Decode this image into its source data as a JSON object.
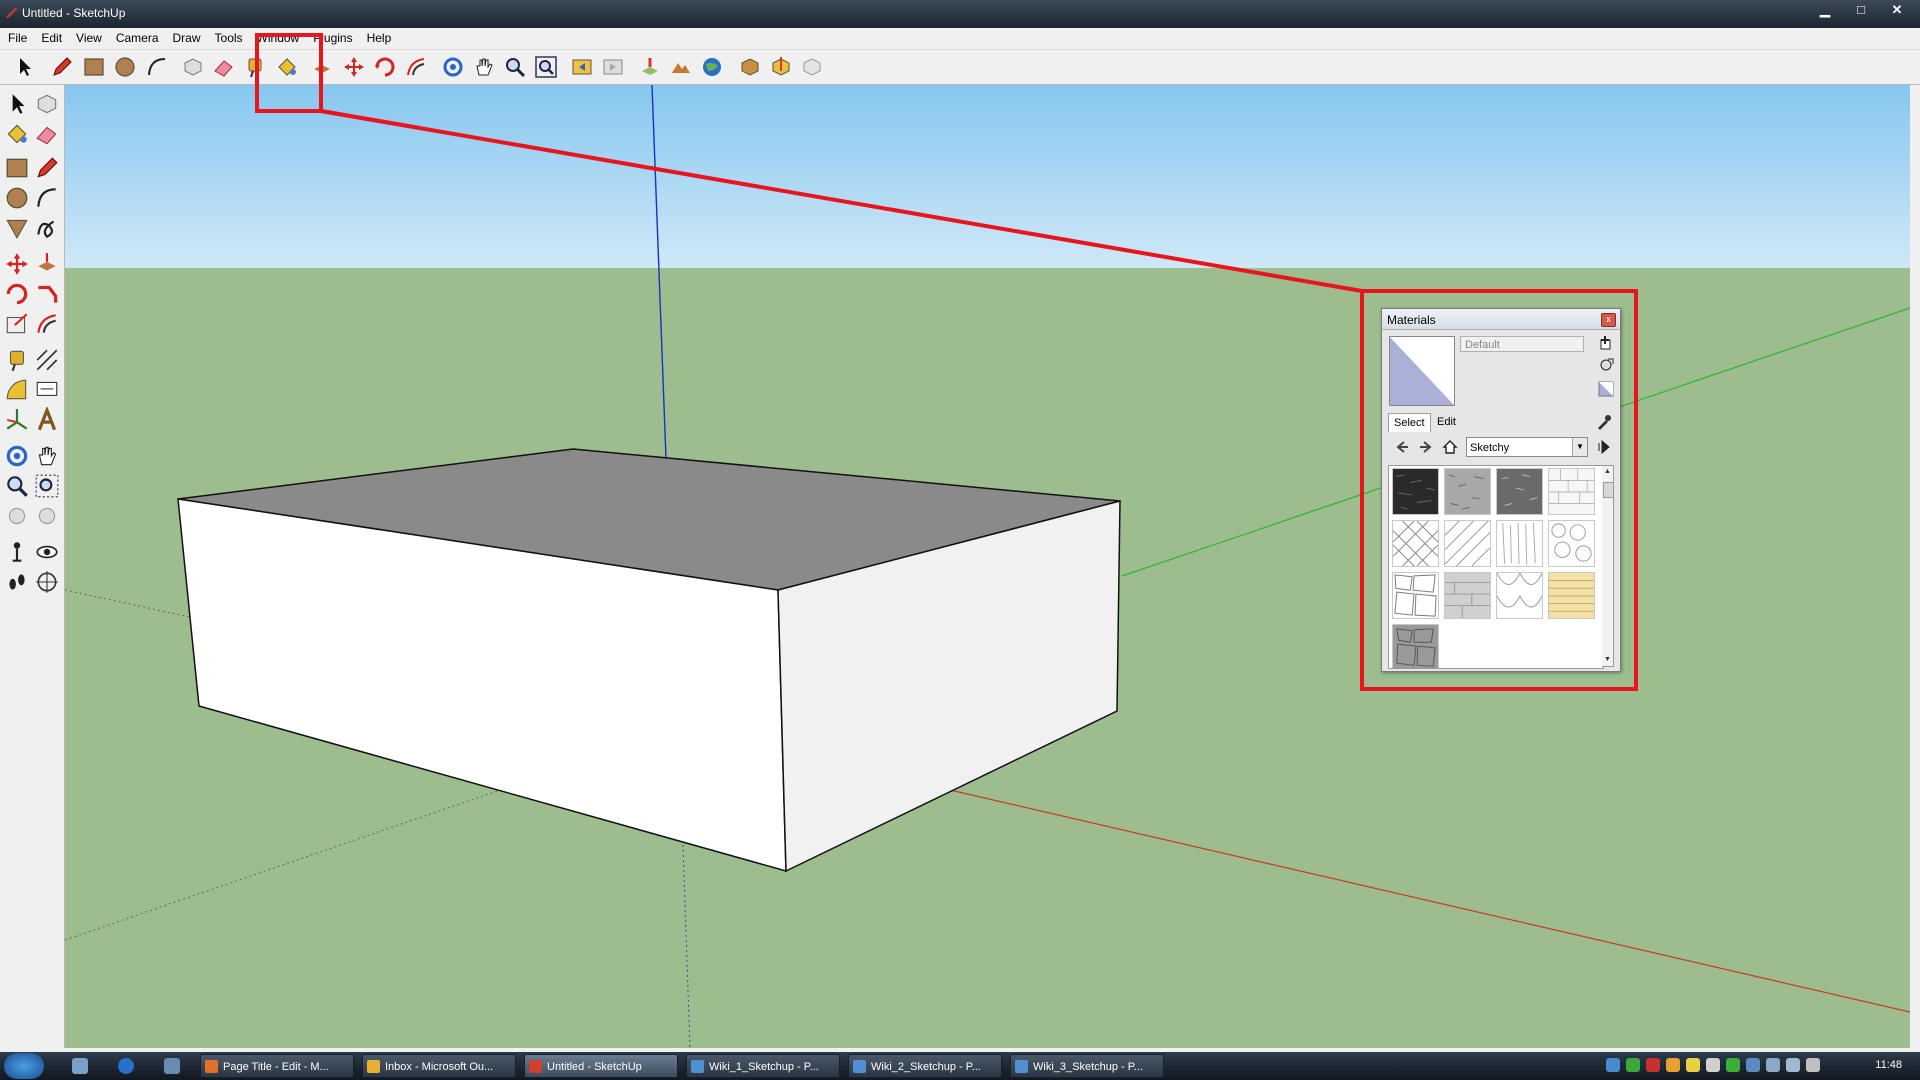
{
  "window": {
    "title": "Untitled - SketchUp",
    "controls": [
      "▁",
      "□",
      "✕"
    ]
  },
  "menu": [
    "File",
    "Edit",
    "View",
    "Camera",
    "Draw",
    "Tools",
    "Window",
    "Plugins",
    "Help"
  ],
  "toolbar_icons": [
    "select-icon",
    "pencil-icon",
    "rectangle-icon",
    "circle-icon",
    "arc-icon",
    "make-component-icon",
    "eraser-icon",
    "tape-measure-icon",
    "paint-bucket-icon",
    "push-pull-icon",
    "move-icon",
    "rotate-icon",
    "offset-icon",
    "orbit-icon",
    "pan-icon",
    "zoom-icon",
    "zoom-extents-icon",
    "previous-view-icon",
    "next-view-icon",
    "add-location-icon",
    "toggle-terrain-icon",
    "google-earth-icon",
    "get-models-icon",
    "share-model-icon",
    "share-component-icon"
  ],
  "materials_panel": {
    "title": "Materials",
    "close_label": "x",
    "material_name": "Default",
    "tabs": {
      "select": "Select",
      "edit": "Edit"
    },
    "library": "Sketchy",
    "swatches": [
      "charcoal-texture",
      "gray-noise-texture",
      "dark-noise-texture",
      "brick-outline-texture",
      "crosshatch-texture",
      "diagonal-hatch-texture",
      "vertical-stroke-texture",
      "stone-outline-texture",
      "flagstone-texture",
      "shingle-texture",
      "scale-texture",
      "wood-plank-texture",
      "stone-block-texture"
    ]
  },
  "taskbar": {
    "buttons": [
      {
        "label": "Page Title - Edit - M...",
        "color": "#e0702a"
      },
      {
        "label": "Inbox - Microsoft Ou...",
        "color": "#e8b030"
      },
      {
        "label": "Untitled - SketchUp",
        "color": "#d04030",
        "active": true
      },
      {
        "label": "Wiki_1_Sketchup - P...",
        "color": "#5090d0"
      },
      {
        "label": "Wiki_2_Sketchup - P...",
        "color": "#5090d0"
      },
      {
        "label": "Wiki_3_Sketchup - P...",
        "color": "#5090d0"
      }
    ],
    "clock": "11:48"
  },
  "colors": {
    "sky_top": "#87c7ef",
    "sky_bottom": "#cfe8f7",
    "ground": "#9dbd8e",
    "highlight": "#e8141e",
    "box_top": "#8a8a8a"
  }
}
